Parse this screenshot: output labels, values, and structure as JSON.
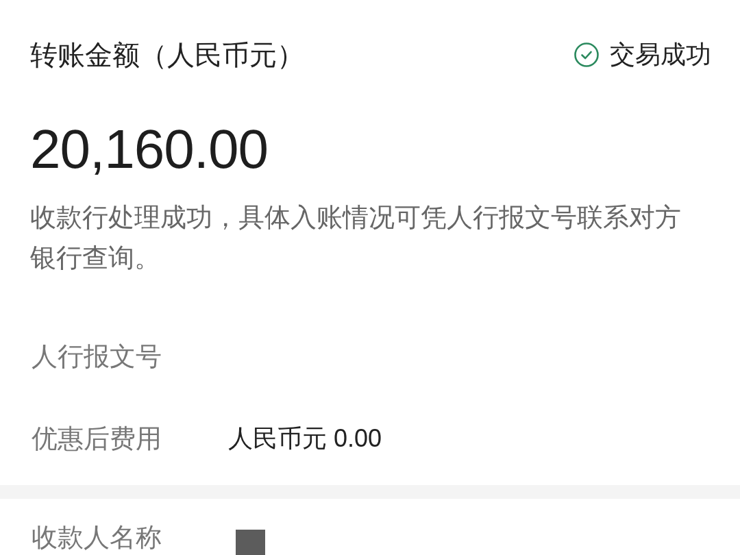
{
  "summary": {
    "label": "转账金额（人民币元）",
    "status": {
      "kind": "success",
      "text": "交易成功"
    },
    "amount": "20,160.00",
    "note": "收款行处理成功，具体入账情况可凭人行报文号联系对方银行查询。"
  },
  "sections": [
    {
      "rows": [
        {
          "label": "人行报文号"
        },
        {
          "label": "优惠后费用",
          "value": "人民币元 0.00"
        }
      ]
    },
    {
      "rows": [
        {
          "label": "收款人名称",
          "redacted": true
        }
      ]
    }
  ]
}
